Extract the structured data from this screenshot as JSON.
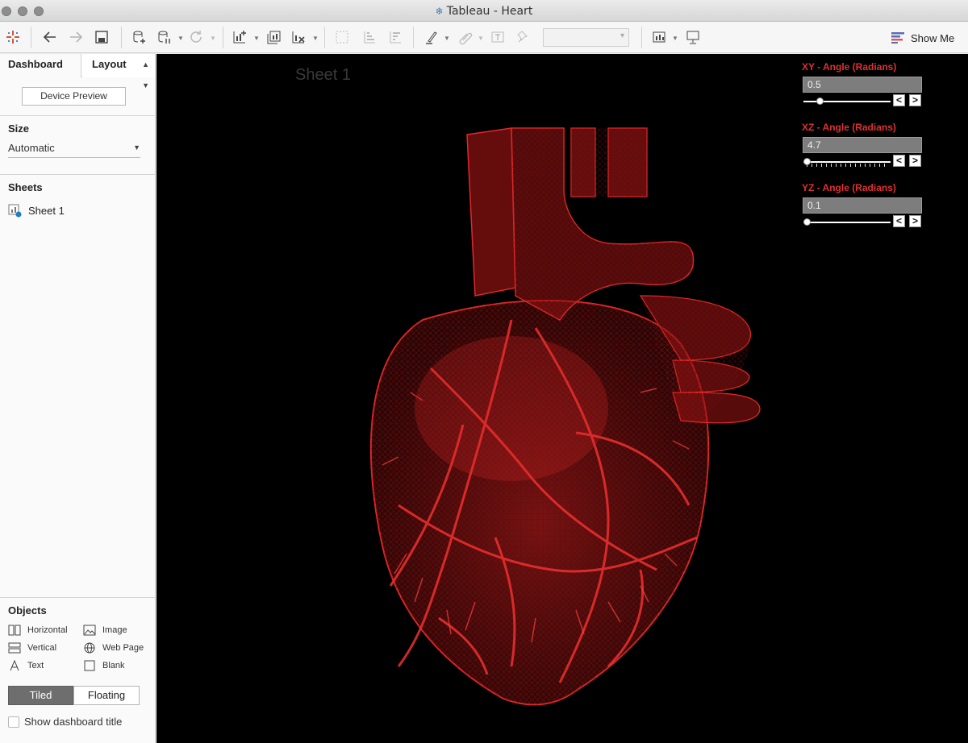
{
  "window": {
    "title": "Tableau - Heart"
  },
  "toolbar": {
    "show_me_label": "Show Me"
  },
  "left_panel": {
    "tabs": [
      {
        "label": "Dashboard",
        "active": true
      },
      {
        "label": "Layout",
        "active": false
      }
    ],
    "device_preview_label": "Device Preview",
    "size": {
      "heading": "Size",
      "value": "Automatic"
    },
    "sheets": {
      "heading": "Sheets",
      "items": [
        "Sheet 1"
      ]
    },
    "objects": {
      "heading": "Objects",
      "items": [
        {
          "label": "Horizontal",
          "icon": "horizontal-container-icon"
        },
        {
          "label": "Image",
          "icon": "image-icon"
        },
        {
          "label": "Vertical",
          "icon": "vertical-container-icon"
        },
        {
          "label": "Web Page",
          "icon": "globe-icon"
        },
        {
          "label": "Text",
          "icon": "text-icon"
        },
        {
          "label": "Blank",
          "icon": "blank-icon"
        }
      ]
    },
    "layout_mode": {
      "options": [
        "Tiled",
        "Floating"
      ],
      "selected": "Tiled"
    },
    "show_title_checkbox": {
      "label": "Show dashboard title",
      "checked": false
    }
  },
  "canvas": {
    "sheet_title": "Sheet 1",
    "background": "#000000",
    "accent_color": "#e22828",
    "parameters": [
      {
        "title": "XY - Angle (Radians)",
        "value": "0.5",
        "slider_fraction": 0.16,
        "ticks": false
      },
      {
        "title": "XZ - Angle (Radians)",
        "value": "4.7",
        "slider_fraction": 0.0,
        "ticks": true
      },
      {
        "title": "YZ - Angle (Radians)",
        "value": "0.1",
        "slider_fraction": 0.0,
        "ticks": false
      }
    ]
  }
}
